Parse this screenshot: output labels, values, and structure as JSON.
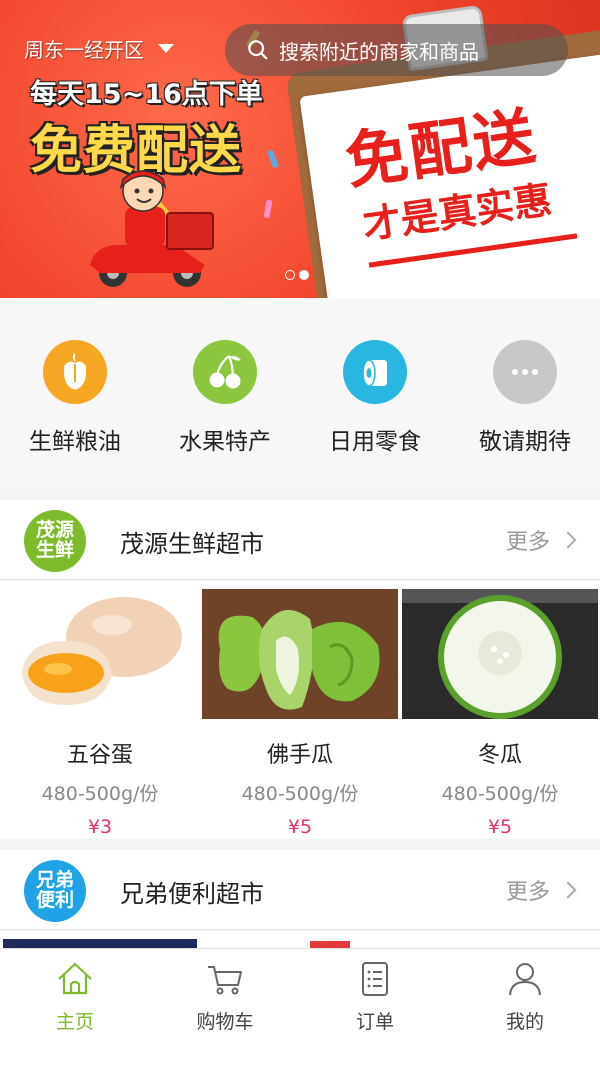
{
  "header": {
    "location": "周东一经开区",
    "search_placeholder": "搜索附近的商家和商品"
  },
  "banner": {
    "line1": "每天15~16点下单",
    "line2": "免费配送",
    "paper_title": "免配送",
    "paper_subtitle": "才是真实惠",
    "slides": 2,
    "active_slide": 2,
    "colors": {
      "background": "#f0432b",
      "accent": "#ffd94a",
      "paper_text": "#e8201c"
    }
  },
  "categories": [
    {
      "label": "生鲜粮油",
      "icon": "pepper-icon",
      "color": "#f5a623"
    },
    {
      "label": "水果特产",
      "icon": "cherry-icon",
      "color": "#8cc63f"
    },
    {
      "label": "日用零食",
      "icon": "tissue-roll-icon",
      "color": "#29b6e0"
    },
    {
      "label": "敬请期待",
      "icon": "more-dots-icon",
      "color": "#c8c8c8"
    }
  ],
  "stores": [
    {
      "name": "茂源生鲜超市",
      "logo_line1": "茂源",
      "logo_line2": "生鲜",
      "logo_color": "#7dbb2d",
      "more": "更多",
      "products": [
        {
          "name": "五谷蛋",
          "spec": "480-500g/份",
          "price": "¥3"
        },
        {
          "name": "佛手瓜",
          "spec": "480-500g/份",
          "price": "¥5"
        },
        {
          "name": "冬瓜",
          "spec": "480-500g/份",
          "price": "¥5"
        }
      ]
    },
    {
      "name": "兄弟便利超市",
      "logo_line1": "兄弟",
      "logo_line2": "便利",
      "logo_color": "#1fa3e6",
      "more": "更多"
    }
  ],
  "tabbar": {
    "active_color": "#7dbb2d",
    "tabs": [
      {
        "label": "主页",
        "icon": "home-icon",
        "active": true
      },
      {
        "label": "购物车",
        "icon": "cart-icon",
        "active": false
      },
      {
        "label": "订单",
        "icon": "order-list-icon",
        "active": false
      },
      {
        "label": "我的",
        "icon": "user-icon",
        "active": false
      }
    ]
  }
}
